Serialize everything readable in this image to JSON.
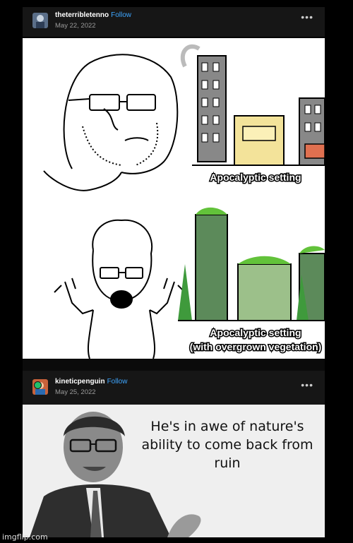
{
  "post1": {
    "username": "theterribletenno",
    "follow_label": "Follow",
    "date": "May 22, 2022",
    "more_icon": "•••",
    "caption_top": "Apocalyptic setting",
    "caption_bottom_1": "Apocalyptic setting",
    "caption_bottom_2": "(with overgrown vegetation)"
  },
  "post2": {
    "username": "kineticpenguin",
    "follow_label": "Follow",
    "date": "May 25, 2022",
    "more_icon": "•••",
    "meme_text": "He's in awe of nature's ability to come back from ruin"
  },
  "watermark": "imgflip.com",
  "colors": {
    "accent": "#3ea6ff",
    "header_bg": "#161616",
    "page_bg": "#000000",
    "badge": "#21c06a"
  }
}
